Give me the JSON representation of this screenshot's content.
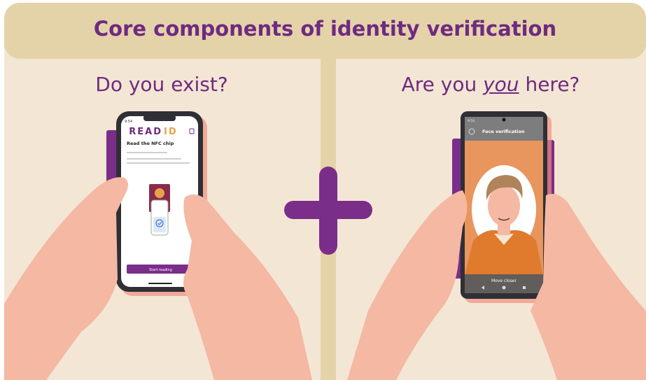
{
  "title": "Core components of identity verification",
  "left": {
    "question": "Do you exist?",
    "phone": {
      "time": "9:54",
      "brand_read": "READ",
      "brand_id": "ID",
      "heading": "Read the NFC chip",
      "button": "Start reading"
    }
  },
  "right": {
    "question_before": "Are you ",
    "question_emphasis": "you",
    "question_after": " here?",
    "phone": {
      "time": "9:54",
      "header": "Face verification",
      "status": "Move closer"
    }
  },
  "colors": {
    "purple": "#6f2a81",
    "band": "#e4d3a9",
    "background": "#f4e6d4",
    "skin": "#f4b8a3",
    "orange": "#e8955e"
  }
}
